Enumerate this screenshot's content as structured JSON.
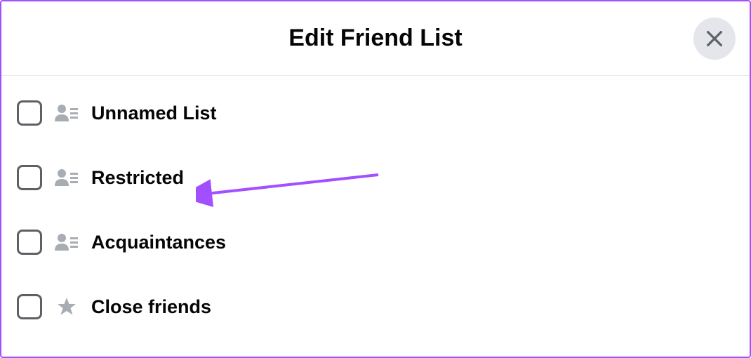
{
  "dialog": {
    "title": "Edit Friend List"
  },
  "items": [
    {
      "label": "Unnamed List",
      "icon": "friend-list"
    },
    {
      "label": "Restricted",
      "icon": "friend-list"
    },
    {
      "label": "Acquaintances",
      "icon": "friend-list"
    },
    {
      "label": "Close friends",
      "icon": "star"
    }
  ]
}
